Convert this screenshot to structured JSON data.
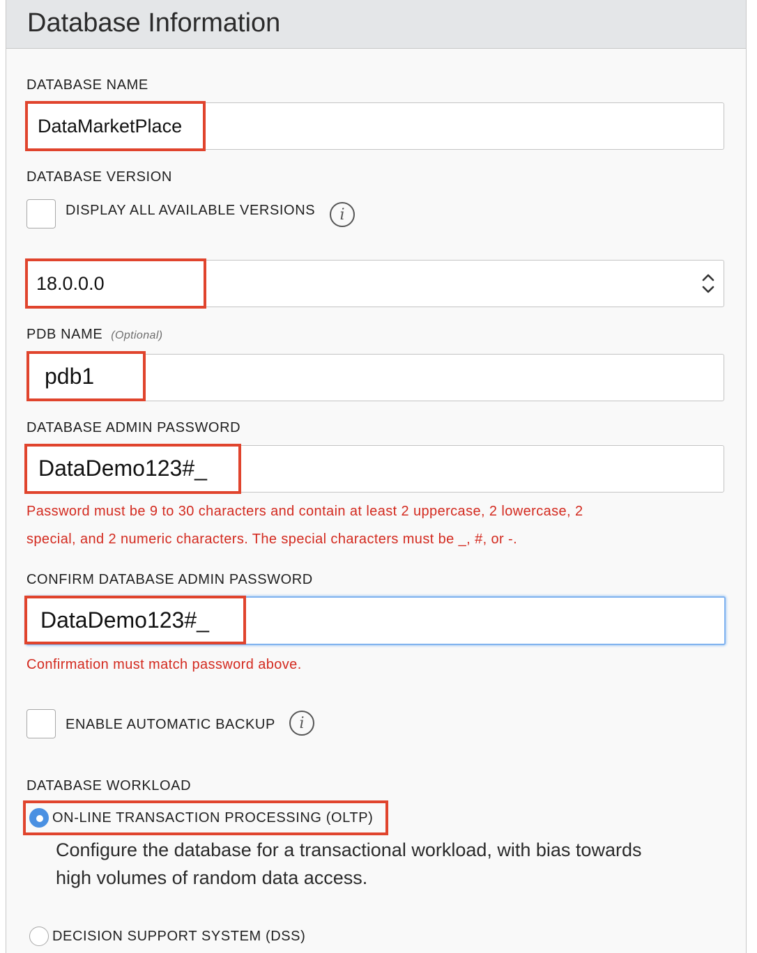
{
  "panel": {
    "title": "Database Information"
  },
  "database_name": {
    "label": "DATABASE NAME",
    "value": "DataMarketPlace"
  },
  "database_version": {
    "label": "DATABASE VERSION",
    "display_all_label": "DISPLAY ALL AVAILABLE VERSIONS",
    "display_all_checked": false,
    "selected": "18.0.0.0"
  },
  "pdb_name": {
    "label": "PDB NAME",
    "optional": "(Optional)",
    "value": "pdb1"
  },
  "admin_password": {
    "label": "DATABASE ADMIN PASSWORD",
    "value": "DataDemo123#_",
    "error_line1": "Password must be 9 to 30 characters and contain at least 2 uppercase, 2 lowercase, 2",
    "error_line2": "special, and 2 numeric characters. The special characters must be _, #, or -."
  },
  "confirm_password": {
    "label": "CONFIRM DATABASE ADMIN PASSWORD",
    "value": "DataDemo123#_",
    "error": "Confirmation must match password above."
  },
  "auto_backup": {
    "label": "ENABLE AUTOMATIC BACKUP",
    "checked": false
  },
  "workload": {
    "label": "DATABASE WORKLOAD",
    "options": [
      {
        "label": "ON-LINE TRANSACTION PROCESSING (OLTP)",
        "selected": true,
        "description_line1": "Configure the database for a transactional workload, with bias towards",
        "description_line2": "high volumes of random data access."
      },
      {
        "label": "DECISION SUPPORT SYSTEM (DSS)",
        "selected": false
      }
    ]
  },
  "colors": {
    "highlight": "#e0442d",
    "error": "#d32a1f",
    "accent": "#4a90e2"
  }
}
